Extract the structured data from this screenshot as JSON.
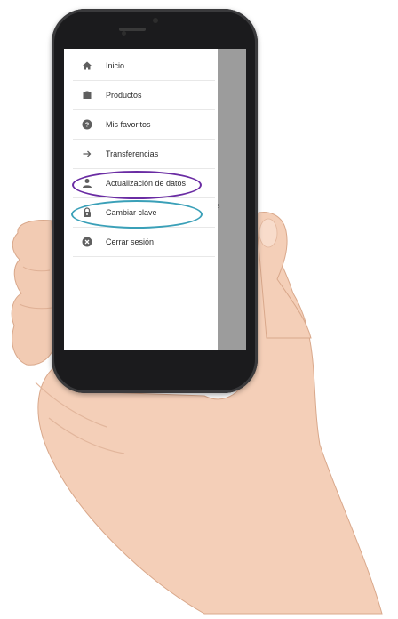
{
  "menu": {
    "items": [
      {
        "icon": "home-icon",
        "label": "Inicio"
      },
      {
        "icon": "briefcase-icon",
        "label": "Productos"
      },
      {
        "icon": "help-circle-icon",
        "label": "Mis favoritos"
      },
      {
        "icon": "arrow-right-icon",
        "label": "Transferencias"
      },
      {
        "icon": "person-icon",
        "label": "Actualización de datos"
      },
      {
        "icon": "lock-icon",
        "label": "Cambiar clave"
      },
      {
        "icon": "close-circle-icon",
        "label": "Cerrar sesión"
      }
    ]
  },
  "background_fragment": "es",
  "colors": {
    "highlight_purple": "#6a2ca3",
    "highlight_teal": "#3aa0b8",
    "icon": "#5f5f5f"
  }
}
